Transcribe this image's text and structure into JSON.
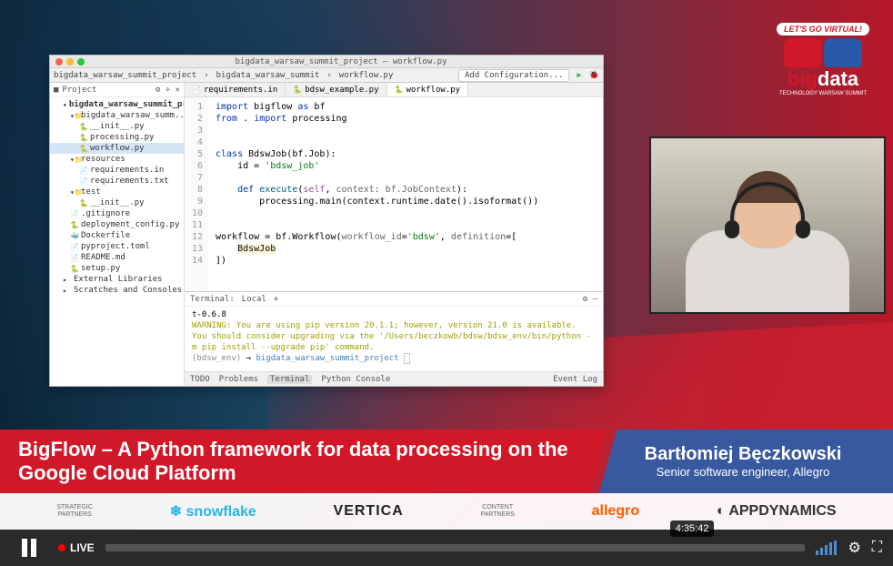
{
  "event": {
    "badge_top": "LET'S GO VIRTUAL!",
    "badge_main_1": "big",
    "badge_main_2": "data",
    "badge_sub": "TECHNOLOGY WARSAW SUMMIT"
  },
  "ide": {
    "title": "bigdata_warsaw_summit_project – workflow.py",
    "toolbar": {
      "project": "bigdata_warsaw_summit_project",
      "sub": "bigdata_warsaw_summit",
      "file": "workflow.py",
      "config_btn": "Add Configuration..."
    },
    "sidebar": {
      "header": "Project",
      "tree": {
        "root": "bigdata_warsaw_summit_project",
        "pkg": "bigdata_warsaw_summ...",
        "f_init": "__init__.py",
        "f_processing": "processing.py",
        "f_workflow": "workflow.py",
        "resources": "resources",
        "r_reqin": "requirements.in",
        "r_reqtxt": "requirements.txt",
        "test": "test",
        "t_init": "__init__.py",
        "gitignore": ".gitignore",
        "deploy": "deployment_config.py",
        "dockerfile": "Dockerfile",
        "pyproject": "pyproject.toml",
        "readme": "README.md",
        "setup": "setup.py",
        "extlib": "External Libraries",
        "scratches": "Scratches and Consoles"
      }
    },
    "tabs": {
      "t1": "requirements.in",
      "t2": "bdsw_example.py",
      "t3": "workflow.py"
    },
    "code": {
      "l1_kw1": "import",
      "l1_mod": "bigflow",
      "l1_kw2": "as",
      "l1_alias": "bf",
      "l2_kw1": "from",
      "l2_dot": ".",
      "l2_kw2": "import",
      "l2_mod": "processing",
      "l5_kw": "class",
      "l5_name": "BdswJob",
      "l5_base": "bf.Job",
      "l6_id": "id",
      "l6_val": "'bdsw_job'",
      "l8_kw": "def",
      "l8_fn": "execute",
      "l8_self": "self",
      "l8_p": "context: bf.JobContext",
      "l9": "processing.main(context.runtime.date().isoformat())",
      "l12_var": "workflow",
      "l12_expr": "bf.Workflow(",
      "l12_kw": "workflow_id",
      "l12_val": "'bdsw'",
      "l12_p2": "definition",
      "l13": "BdswJob",
      "l14": "])"
    },
    "gutter": [
      "1",
      "2",
      "3",
      "4",
      "5",
      "6",
      "7",
      "8",
      "9",
      "10",
      "11",
      "12",
      "13",
      "14"
    ],
    "terminal": {
      "tab_label": "Terminal:",
      "tab1": "Local",
      "line0": "t-0.6.8",
      "warn1": "WARNING: You are using pip version 20.1.1; however, version 21.0 is available.",
      "warn2": "You should consider upgrading via the '/Users/beczkowb/bdsw/bdsw_env/bin/python -m pip install --upgrade pip' command.",
      "prompt_env": "(bdsw_env)",
      "prompt_path": "bigdata_warsaw_summit_project"
    },
    "bottom_tabs": {
      "todo": "TODO",
      "problems": "Problems",
      "terminal": "Terminal",
      "python": "Python Console",
      "event_log": "Event Log"
    }
  },
  "lower_third": {
    "title": "BigFlow – A Python framework for data processing on the Google Cloud Platform",
    "speaker_name": "Bartłomiej Bęczkowski",
    "speaker_role": "Senior software engineer, Allegro"
  },
  "sponsors": {
    "strategic_label": "STRATEGIC\nPARTNERS",
    "snowflake": "❄ snowflake",
    "vertica": "VERTICA",
    "content_label": "CONTENT\nPARTNERS",
    "allegro": "allegro",
    "appdynamics": "APPDYNAMICS"
  },
  "player": {
    "live_label": "LIVE",
    "time_tip": "4:35:42"
  }
}
